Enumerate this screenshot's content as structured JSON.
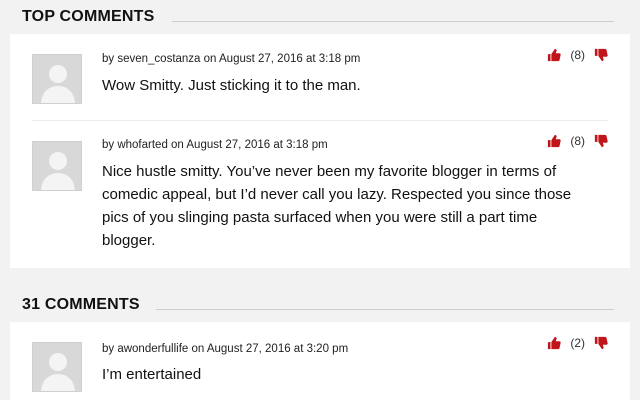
{
  "top_comments": {
    "heading": "TOP COMMENTS",
    "items": [
      {
        "meta": "by seven_costanza on August 27, 2016 at 3:18 pm",
        "text": "Wow Smitty. Just sticking it to the man.",
        "vote_count": "(8)"
      },
      {
        "meta": "by whofarted on August 27, 2016 at 3:18 pm",
        "text": "Nice hustle smitty. You’ve never been my favorite blogger in terms of comedic appeal, but I’d never call you lazy. Respected you since those pics of you slinging pasta surfaced when you were still a part time blogger.",
        "vote_count": "(8)"
      }
    ]
  },
  "all_comments": {
    "heading": "31 COMMENTS",
    "items": [
      {
        "meta": "by awonderfullife on August 27, 2016 at 3:20 pm",
        "text": "I’m entertained",
        "vote_count": "(2)"
      }
    ]
  },
  "icons": {
    "upvote": "thumbs-up-icon",
    "downvote": "thumbs-down-icon",
    "avatar": "default-avatar"
  },
  "colors": {
    "vote_red": "#c0151b",
    "background": "#f2f2f2"
  }
}
